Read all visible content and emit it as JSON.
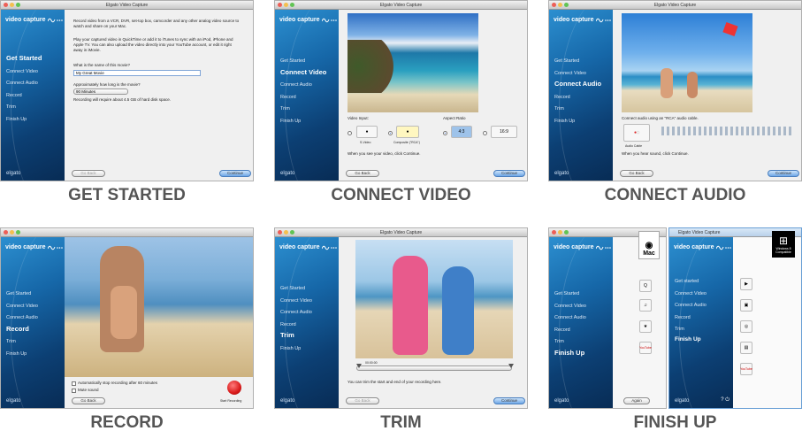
{
  "window_title": "Elgato Video Capture",
  "app_logo": "video capture",
  "brand": "elgato",
  "steps": [
    "Get Started",
    "Connect Video",
    "Connect Audio",
    "Record",
    "Trim",
    "Finish Up"
  ],
  "steps_lower": [
    "Get started",
    "Connect Video",
    "Connect Audio",
    "Record",
    "Trim",
    "Finish Up"
  ],
  "buttons": {
    "go_back": "Go Back",
    "continue": "Continue",
    "again": "Again"
  },
  "panels": [
    {
      "caption": "GET STARTED",
      "intro1": "Record video from a VCR, DVR, set-top box, camcorder and any other analog video source to watch and share on your Mac.",
      "intro2": "Play your captured video in QuickTime or add it to iTunes to sync with an iPod, iPhone and Apple TV. You can also upload the video directly into your YouTube account, or edit it right away in iMovie.",
      "name_label": "What is the name of this movie?",
      "name_value": "My Great Movie",
      "length_label": "Approximately how long is the movie?",
      "length_value": "90 Minutes",
      "space_note": "Recording will require about 4.5 GB of hard disk space."
    },
    {
      "caption": "CONNECT VIDEO",
      "video_input_label": "Video Input:",
      "aspect_label": "Aspect Ratio",
      "svideo": "S-Video",
      "composite": "Composite (\"RCA\")",
      "ratio_43": "4:3",
      "ratio_169": "16:9",
      "note": "When you see your video, click Continue."
    },
    {
      "caption": "CONNECT AUDIO",
      "instruction": "Connect audio using an \"RCA\" audio cable.",
      "cable_label": "Audio Cable",
      "note": "When you hear sound, click Continue."
    },
    {
      "caption": "RECORD",
      "auto_stop": "Automatically stop recording after 60 minutes",
      "mute": "Mute sound",
      "start": "Start Recording"
    },
    {
      "caption": "TRIM",
      "time": "00:00:00",
      "note": "You can trim the start and end of your recording here."
    },
    {
      "caption": "FINISH UP",
      "mac_label": "Mac",
      "windows_label": "Windows 8 Compatible",
      "youtube": "YouTube"
    }
  ],
  "colors": {
    "accent": "#1667a8",
    "caption": "#555555",
    "record_button": "#d91a1a"
  }
}
